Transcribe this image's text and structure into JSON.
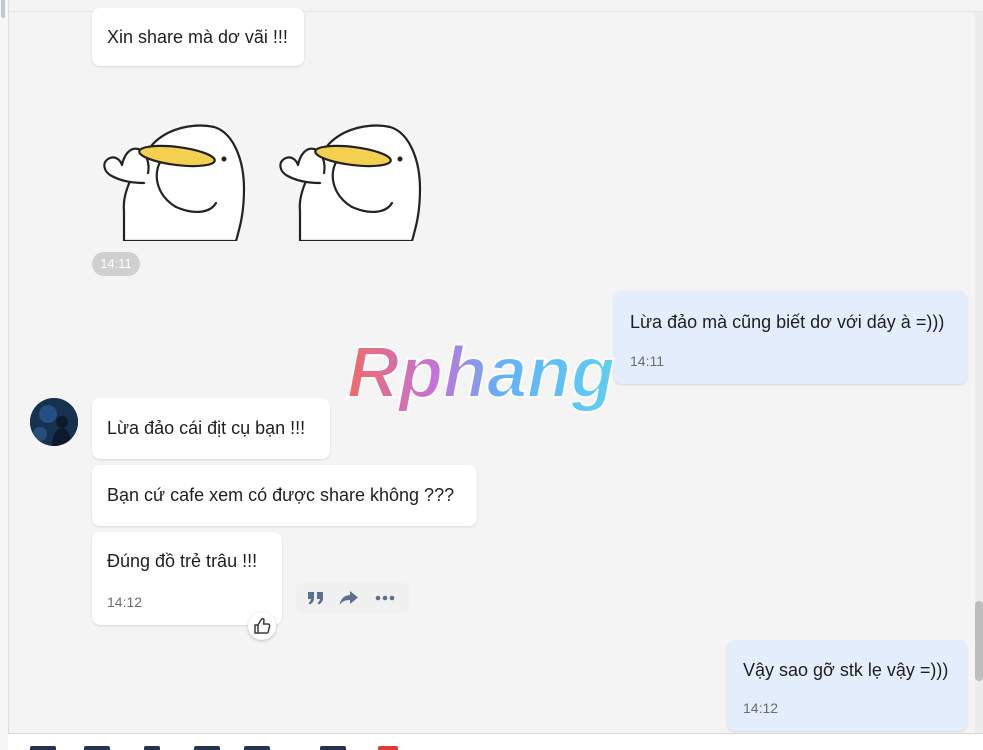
{
  "messages": [
    {
      "text": "Xin share mà dơ vãi !!!"
    },
    {
      "time": "14:11"
    },
    {
      "text": "Lừa đảo mà cũng biết dơ với dáy à =)))",
      "time": "14:11"
    },
    {
      "text": "Lừa đảo cái địt cụ bạn !!!"
    },
    {
      "text": "Bạn cứ cafe xem có được share không ???"
    },
    {
      "text": "Đúng đồ trẻ trâu !!!",
      "time": "14:12"
    },
    {
      "text": "Vậy sao gỡ stk lẹ vậy =)))",
      "time": "14:12"
    }
  ],
  "watermark": {
    "text": "Rphang"
  },
  "icons": {
    "quote": "quote-icon",
    "forward": "forward-icon",
    "more": "more-icon",
    "like": "thumbs-up-icon",
    "sticker": "duck-sticker-icon"
  },
  "colors": {
    "background": "#f4f4f4",
    "incoming_bubble": "#ffffff",
    "outgoing_bubble": "#e3edfc",
    "timestamp_pill": "#cfcfcf",
    "sticker_bill": "#f3d04f",
    "watermark_red": "#ef5350",
    "watermark_blue": "#4aa6ff"
  }
}
